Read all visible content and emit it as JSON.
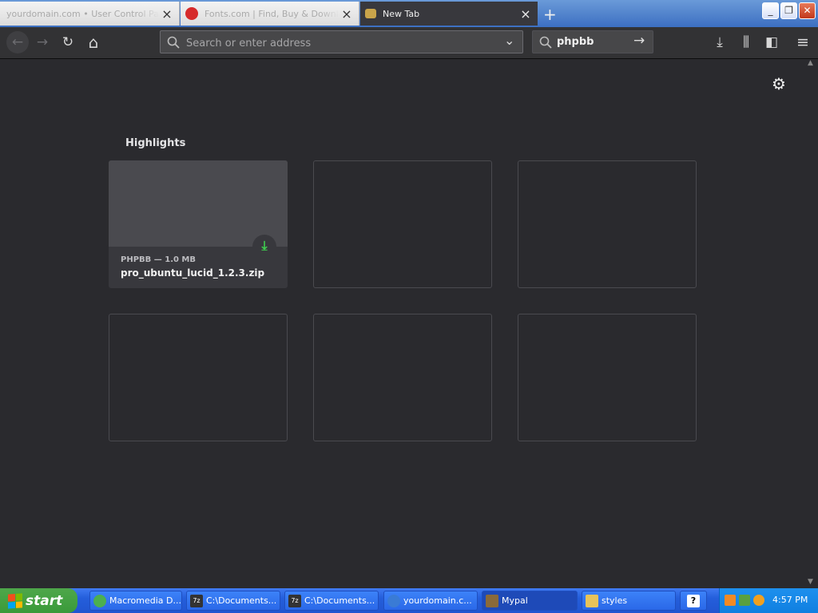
{
  "tabs": [
    {
      "title": "yourdomain.com • User Control Panel",
      "active": false
    },
    {
      "title": "Fonts.com | Find, Buy & Download",
      "active": false
    },
    {
      "title": "New Tab",
      "active": true
    }
  ],
  "newtab_symbol": "+",
  "window_controls": {
    "minimize": "_",
    "restore": "❐",
    "close": "✕"
  },
  "toolbar": {
    "back_icon": "←",
    "forward_icon": "→",
    "reload_icon": "↻",
    "home_icon": "⌂",
    "urlbar_placeholder": "Search or enter address",
    "urlbar_dropdown_icon": "⌄",
    "search_value": "phpbb",
    "search_go_icon": "→",
    "downloads_icon": "⤓",
    "library_icon": "⫼",
    "sidebar_icon": "◧",
    "menu_icon": "≡"
  },
  "newtab": {
    "settings_icon": "⚙",
    "highlights_title": "Highlights",
    "highlight_card": {
      "source": "PHPBB — 1.0 MB",
      "filename": "pro_ubuntu_lucid_1.2.3.zip",
      "download_icon": "⤓"
    }
  },
  "taskbar": {
    "start_label": "start",
    "tasks": [
      {
        "label": "Macromedia D...",
        "icon_color": "#4caf50"
      },
      {
        "label": "C:\\Documents...",
        "icon_color": "#333333"
      },
      {
        "label": "C:\\Documents...",
        "icon_color": "#333333"
      },
      {
        "label": "yourdomain.c...",
        "icon_color": "#3a7bd5"
      },
      {
        "label": "Mypal",
        "icon_color": "#8a6a3a"
      },
      {
        "label": "styles",
        "icon_color": "#e8c35a"
      },
      {
        "label": "?",
        "icon_color": "#ffffff"
      }
    ],
    "clock": "4:57 PM"
  }
}
